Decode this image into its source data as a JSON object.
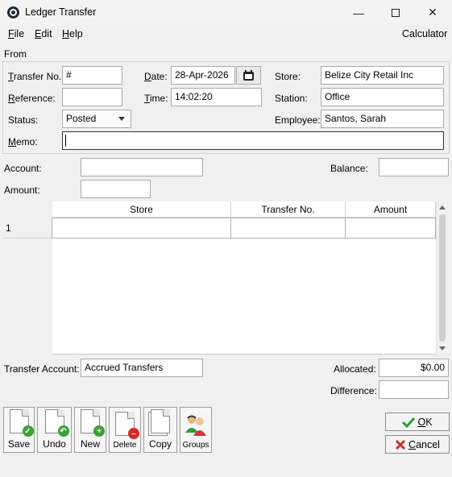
{
  "window": {
    "title": "Ledger Transfer"
  },
  "menu": {
    "file": "F",
    "file_rest": "ile",
    "edit": "E",
    "edit_rest": "dit",
    "help": "H",
    "help_rest": "elp",
    "calculator": "Calculator"
  },
  "form": {
    "from_label": "From",
    "transfer_no": {
      "label_u": "T",
      "label_rest": "ransfer No.",
      "value": "#"
    },
    "reference": {
      "label_u": "R",
      "label_rest": "eference:",
      "value": ""
    },
    "status": {
      "label": "Status:",
      "value": "Posted"
    },
    "memo": {
      "label_u": "M",
      "label_rest": "emo:",
      "value": ""
    },
    "date": {
      "label_u": "D",
      "label_rest": "ate:",
      "value": "28-Apr-2026"
    },
    "time": {
      "label_u": "T",
      "label_rest": "ime:",
      "value": "14:02:20"
    },
    "store": {
      "label": "Store:",
      "value": "Belize City Retail Inc"
    },
    "station": {
      "label": "Station:",
      "value": "Office"
    },
    "employee": {
      "label": "Employee:",
      "value": "Santos, Sarah"
    }
  },
  "account": {
    "label": "Account:",
    "value": ""
  },
  "amount": {
    "label": "Amount:",
    "value": ""
  },
  "balance": {
    "label": "Balance:",
    "value": ""
  },
  "grid": {
    "columns": [
      "Store",
      "Transfer No.",
      "Amount"
    ],
    "rows": [
      {
        "num": "1",
        "store": "",
        "transfer_no": "",
        "amount": ""
      }
    ]
  },
  "footer": {
    "transfer_account": {
      "label": "Transfer Account:",
      "value": "Accrued Transfers"
    },
    "allocated": {
      "label": "Allocated:",
      "value": "$0.00"
    },
    "difference": {
      "label": "Difference:",
      "value": ""
    }
  },
  "toolbar": {
    "save": "Save",
    "undo": "Undo",
    "new": "New",
    "delete": "Delete",
    "copy": "Copy",
    "groups": "Groups"
  },
  "buttons": {
    "ok_u": "O",
    "ok_rest": "K",
    "cancel_u": "C",
    "cancel_rest": "ancel"
  },
  "colors": {
    "accent": "#1f2d3a",
    "save_badge": "#3aa335",
    "undo_badge": "#3aa335",
    "new_badge": "#3aa335",
    "delete_badge": "#d42a2a"
  }
}
